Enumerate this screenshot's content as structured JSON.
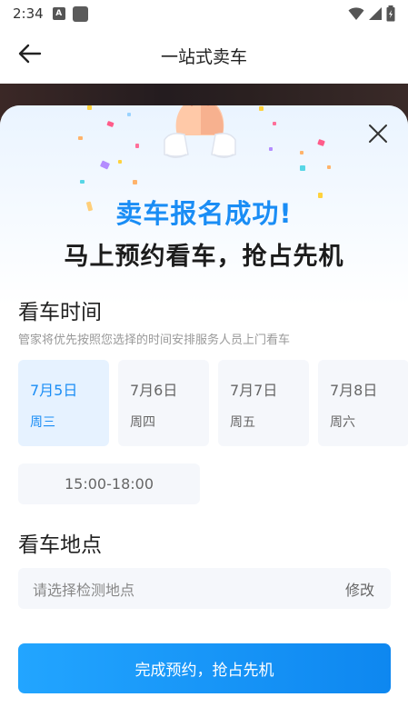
{
  "status_bar": {
    "time": "2:34",
    "notification_letter": "A",
    "icons": [
      "notification-icon",
      "app-icon",
      "wifi-icon",
      "signal-icon",
      "battery-icon"
    ]
  },
  "header": {
    "title": "一站式卖车",
    "back_icon": "arrow-left-icon"
  },
  "modal": {
    "close_icon": "close-icon",
    "illustration": "clapping-hands",
    "success_title": "卖车报名成功!",
    "success_subtitle": "马上预约看车，抢占先机"
  },
  "viewing_time": {
    "title": "看车时间",
    "hint": "管家将优先按照您选择的时间安排服务人员上门看车",
    "dates": [
      {
        "day": "7月5日",
        "week": "周三",
        "selected": true
      },
      {
        "day": "7月6日",
        "week": "周四",
        "selected": false
      },
      {
        "day": "7月7日",
        "week": "周五",
        "selected": false
      },
      {
        "day": "7月8日",
        "week": "周六",
        "selected": false
      }
    ],
    "time_slot": "15:00-18:00"
  },
  "viewing_location": {
    "title": "看车地点",
    "placeholder": "请选择检测地点",
    "edit_label": "修改"
  },
  "submit": {
    "label": "完成预约，抢占先机"
  },
  "colors": {
    "accent": "#1a8df5",
    "selected_bg": "#e6f2ff",
    "card_bg": "#f5f7fb"
  }
}
